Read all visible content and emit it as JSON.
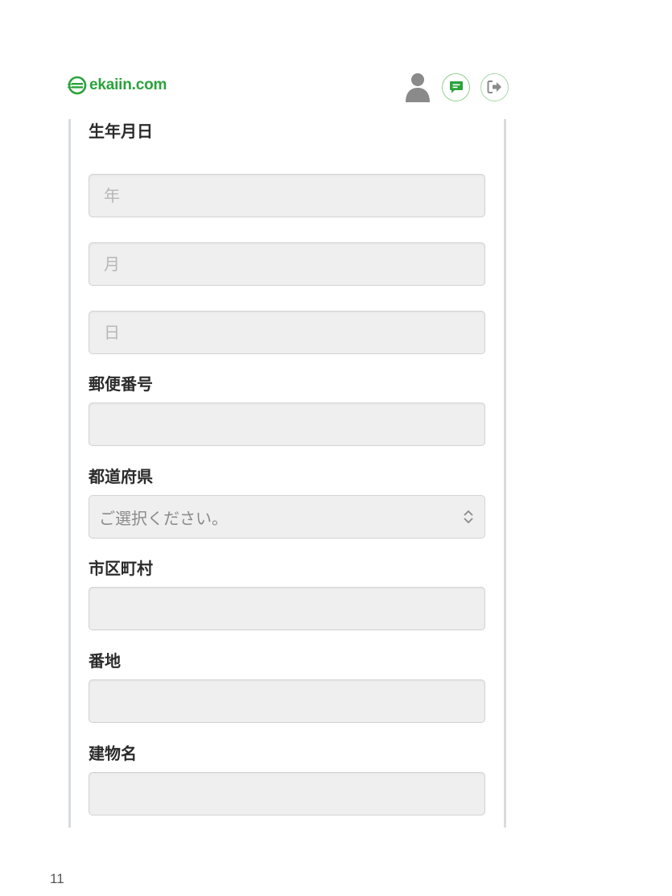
{
  "header": {
    "logo_text": "ekaiin.com",
    "icons": {
      "user": "user-icon",
      "message": "message-icon",
      "logout": "logout-icon"
    },
    "brand_color": "#2aa33b"
  },
  "form": {
    "birthdate": {
      "label": "生年月日",
      "year_placeholder": "年",
      "month_placeholder": "月",
      "day_placeholder": "日"
    },
    "postal_code": {
      "label": "郵便番号",
      "value": ""
    },
    "prefecture": {
      "label": "都道府県",
      "selected": "ご選択ください。"
    },
    "city": {
      "label": "市区町村",
      "value": ""
    },
    "street": {
      "label": "番地",
      "value": ""
    },
    "building": {
      "label": "建物名",
      "value": ""
    }
  },
  "footer": {
    "page_number": "11"
  }
}
